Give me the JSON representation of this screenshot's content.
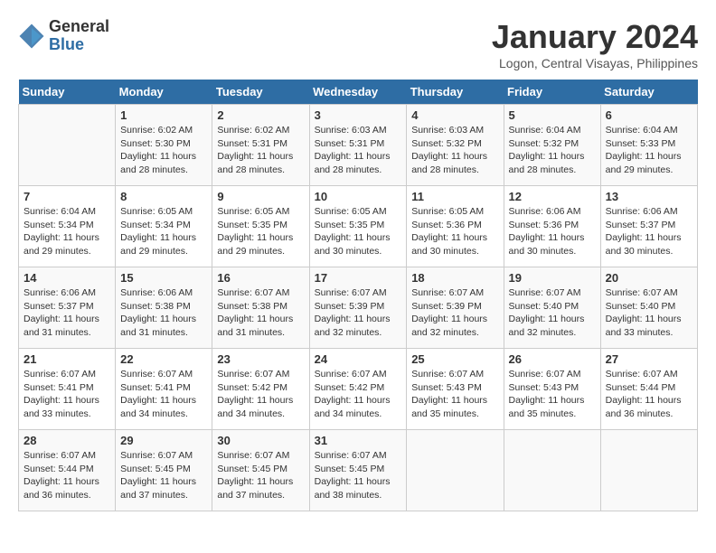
{
  "header": {
    "logo_general": "General",
    "logo_blue": "Blue",
    "month_title": "January 2024",
    "location": "Logon, Central Visayas, Philippines"
  },
  "weekdays": [
    "Sunday",
    "Monday",
    "Tuesday",
    "Wednesday",
    "Thursday",
    "Friday",
    "Saturday"
  ],
  "weeks": [
    [
      {
        "day": "",
        "info": ""
      },
      {
        "day": "1",
        "info": "Sunrise: 6:02 AM\nSunset: 5:30 PM\nDaylight: 11 hours\nand 28 minutes."
      },
      {
        "day": "2",
        "info": "Sunrise: 6:02 AM\nSunset: 5:31 PM\nDaylight: 11 hours\nand 28 minutes."
      },
      {
        "day": "3",
        "info": "Sunrise: 6:03 AM\nSunset: 5:31 PM\nDaylight: 11 hours\nand 28 minutes."
      },
      {
        "day": "4",
        "info": "Sunrise: 6:03 AM\nSunset: 5:32 PM\nDaylight: 11 hours\nand 28 minutes."
      },
      {
        "day": "5",
        "info": "Sunrise: 6:04 AM\nSunset: 5:32 PM\nDaylight: 11 hours\nand 28 minutes."
      },
      {
        "day": "6",
        "info": "Sunrise: 6:04 AM\nSunset: 5:33 PM\nDaylight: 11 hours\nand 29 minutes."
      }
    ],
    [
      {
        "day": "7",
        "info": "Sunrise: 6:04 AM\nSunset: 5:34 PM\nDaylight: 11 hours\nand 29 minutes."
      },
      {
        "day": "8",
        "info": "Sunrise: 6:05 AM\nSunset: 5:34 PM\nDaylight: 11 hours\nand 29 minutes."
      },
      {
        "day": "9",
        "info": "Sunrise: 6:05 AM\nSunset: 5:35 PM\nDaylight: 11 hours\nand 29 minutes."
      },
      {
        "day": "10",
        "info": "Sunrise: 6:05 AM\nSunset: 5:35 PM\nDaylight: 11 hours\nand 30 minutes."
      },
      {
        "day": "11",
        "info": "Sunrise: 6:05 AM\nSunset: 5:36 PM\nDaylight: 11 hours\nand 30 minutes."
      },
      {
        "day": "12",
        "info": "Sunrise: 6:06 AM\nSunset: 5:36 PM\nDaylight: 11 hours\nand 30 minutes."
      },
      {
        "day": "13",
        "info": "Sunrise: 6:06 AM\nSunset: 5:37 PM\nDaylight: 11 hours\nand 30 minutes."
      }
    ],
    [
      {
        "day": "14",
        "info": "Sunrise: 6:06 AM\nSunset: 5:37 PM\nDaylight: 11 hours\nand 31 minutes."
      },
      {
        "day": "15",
        "info": "Sunrise: 6:06 AM\nSunset: 5:38 PM\nDaylight: 11 hours\nand 31 minutes."
      },
      {
        "day": "16",
        "info": "Sunrise: 6:07 AM\nSunset: 5:38 PM\nDaylight: 11 hours\nand 31 minutes."
      },
      {
        "day": "17",
        "info": "Sunrise: 6:07 AM\nSunset: 5:39 PM\nDaylight: 11 hours\nand 32 minutes."
      },
      {
        "day": "18",
        "info": "Sunrise: 6:07 AM\nSunset: 5:39 PM\nDaylight: 11 hours\nand 32 minutes."
      },
      {
        "day": "19",
        "info": "Sunrise: 6:07 AM\nSunset: 5:40 PM\nDaylight: 11 hours\nand 32 minutes."
      },
      {
        "day": "20",
        "info": "Sunrise: 6:07 AM\nSunset: 5:40 PM\nDaylight: 11 hours\nand 33 minutes."
      }
    ],
    [
      {
        "day": "21",
        "info": "Sunrise: 6:07 AM\nSunset: 5:41 PM\nDaylight: 11 hours\nand 33 minutes."
      },
      {
        "day": "22",
        "info": "Sunrise: 6:07 AM\nSunset: 5:41 PM\nDaylight: 11 hours\nand 34 minutes."
      },
      {
        "day": "23",
        "info": "Sunrise: 6:07 AM\nSunset: 5:42 PM\nDaylight: 11 hours\nand 34 minutes."
      },
      {
        "day": "24",
        "info": "Sunrise: 6:07 AM\nSunset: 5:42 PM\nDaylight: 11 hours\nand 34 minutes."
      },
      {
        "day": "25",
        "info": "Sunrise: 6:07 AM\nSunset: 5:43 PM\nDaylight: 11 hours\nand 35 minutes."
      },
      {
        "day": "26",
        "info": "Sunrise: 6:07 AM\nSunset: 5:43 PM\nDaylight: 11 hours\nand 35 minutes."
      },
      {
        "day": "27",
        "info": "Sunrise: 6:07 AM\nSunset: 5:44 PM\nDaylight: 11 hours\nand 36 minutes."
      }
    ],
    [
      {
        "day": "28",
        "info": "Sunrise: 6:07 AM\nSunset: 5:44 PM\nDaylight: 11 hours\nand 36 minutes."
      },
      {
        "day": "29",
        "info": "Sunrise: 6:07 AM\nSunset: 5:45 PM\nDaylight: 11 hours\nand 37 minutes."
      },
      {
        "day": "30",
        "info": "Sunrise: 6:07 AM\nSunset: 5:45 PM\nDaylight: 11 hours\nand 37 minutes."
      },
      {
        "day": "31",
        "info": "Sunrise: 6:07 AM\nSunset: 5:45 PM\nDaylight: 11 hours\nand 38 minutes."
      },
      {
        "day": "",
        "info": ""
      },
      {
        "day": "",
        "info": ""
      },
      {
        "day": "",
        "info": ""
      }
    ]
  ]
}
